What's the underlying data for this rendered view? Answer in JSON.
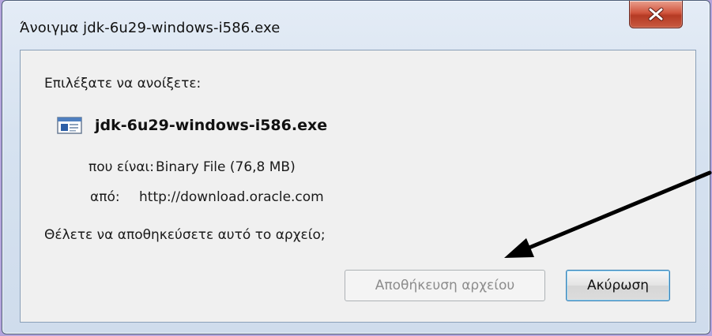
{
  "window": {
    "title": "Άνοιγμα jdk-6u29-windows-i586.exe",
    "close_icon": "close-x-icon"
  },
  "dialog": {
    "prompt": "Επιλέξατε να ανοίξετε:",
    "file_icon": "executable-file-icon",
    "file_name": "jdk-6u29-windows-i586.exe",
    "type_label": "που είναι:",
    "type_value": "Binary File (76,8 MB)",
    "from_label": "από:",
    "from_value": "http://download.oracle.com",
    "question": "Θέλετε να αποθηκεύσετε αυτό το αρχείο;"
  },
  "buttons": {
    "save_label": "Αποθήκευση αρχείου",
    "save_state": "disabled",
    "cancel_label": "Ακύρωση"
  },
  "annotation": {
    "arrow_color": "#000000",
    "arrow_target": "save-file-button"
  }
}
